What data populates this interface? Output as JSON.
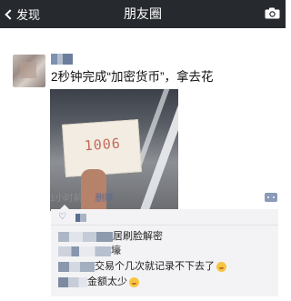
{
  "navbar": {
    "back_label": "发现",
    "title": "朋友圈",
    "camera_icon": "camera-icon"
  },
  "post": {
    "text": "2秒钟完成“加密货币”，拿去花",
    "photo_caption": "1006",
    "time": "1小时前",
    "delete_label": "删除"
  },
  "comments": [
    {
      "text": "居刷脸解密"
    },
    {
      "text": "壕"
    },
    {
      "text": "交易个几次就记录不下去了",
      "emoji": "grinning-sweat-emoji"
    },
    {
      "text": "金额太少",
      "emoji": "smile-emoji"
    }
  ],
  "colors": {
    "navbar_bg": "#26292e",
    "link_blue": "#576b95",
    "comment_bg": "#f3f3f5",
    "meta_gray": "#8c8c8c"
  }
}
